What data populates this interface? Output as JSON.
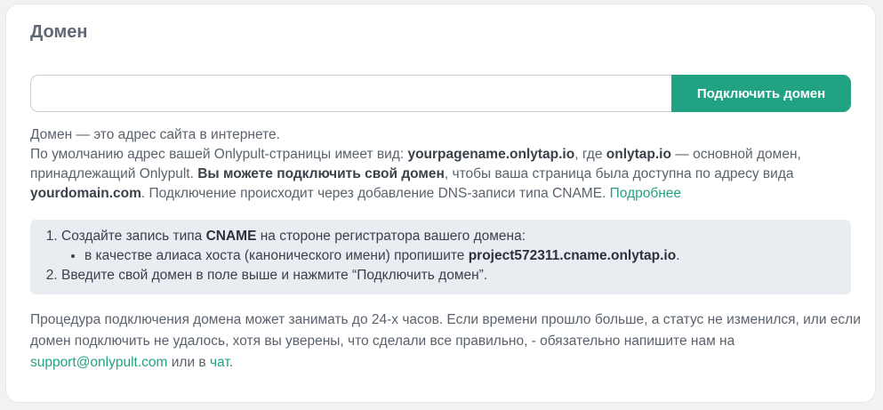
{
  "card": {
    "title": "Домен"
  },
  "form": {
    "input_value": "",
    "input_placeholder": "",
    "button_label": "Подключить домен"
  },
  "description": {
    "line1": "Домен — это адрес сайта в интернете.",
    "line2_part1": "По умолчанию адрес вашей Onlypult-страницы имеет вид: ",
    "default_address": "yourpagename.onlytap.io",
    "line2_part2": ", где ",
    "main_domain": "onlytap.io",
    "line2_part3": " — основной домен, принадлежащий Onlypult. ",
    "bold_cta": "Вы можете подключить свой домен",
    "line2_part4": ", чтобы ваша страница была доступна по адресу вида ",
    "example_domain": "yourdomain.com",
    "line2_part5": ". Подключение происходит через добавление DNS-записи типа CNAME. ",
    "more_link": "Подробнее"
  },
  "steps": {
    "step1_part1": "Создайте запись типа ",
    "step1_bold": "CNAME",
    "step1_part2": " на стороне регистратора вашего домена:",
    "substep_part1": "в качестве алиаса хоста (канонического имени) пропишите ",
    "substep_bold": "project572311.cname.onlytap.io",
    "substep_part2": ".",
    "step2": "Введите свой домен в поле выше и нажмите “Подключить домен”."
  },
  "note": {
    "text": "Процедура подключения домена может занимать до 24-х часов. Если времени прошло больше, а статус не изменился, или если домен подключить не удалось, хотя вы уверены, что сделали все правильно, - обязательно напишите нам на ",
    "email_link": "support@onlypult.com",
    "middle": " или в ",
    "chat_link": "чат",
    "end": "."
  },
  "colors": {
    "accent": "#21a383",
    "info_box_bg": "#e9ecf0",
    "page_bg": "#f1f2f4"
  }
}
